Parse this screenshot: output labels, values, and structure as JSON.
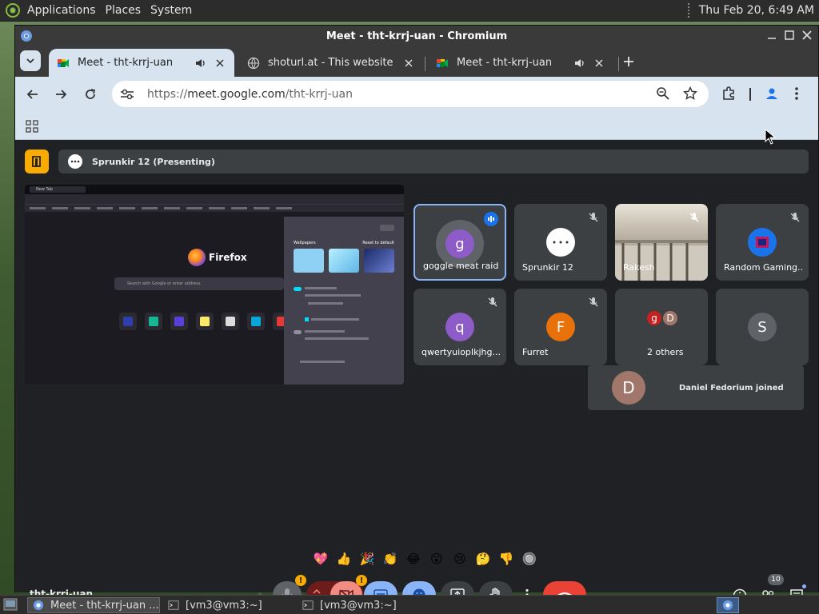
{
  "top_panel": {
    "menus": [
      "Applications",
      "Places",
      "System"
    ],
    "clock": "Thu Feb 20,  6:49 AM"
  },
  "window": {
    "title": "Meet - tht-krrj-uan - Chromium"
  },
  "tabs": [
    {
      "label": "Meet - tht-krrj-uan",
      "active": true,
      "audio": true
    },
    {
      "label": "shoturl.at - This website is fo",
      "active": false,
      "audio": false
    },
    {
      "label": "Meet - tht-krrj-uan",
      "active": false,
      "audio": true
    }
  ],
  "omnibox": {
    "scheme": "https://",
    "host": "meet.google.com",
    "path": "/tht-krrj-uan"
  },
  "meet": {
    "presenting_label": "Sprunkir 12 (Presenting)",
    "meeting_code": "tht-krrj-uan",
    "participant_count": "10",
    "shared_screen": {
      "tab_label": "New Tab",
      "brand": "Firefox",
      "search_placeholder": "Search with Google or enter address",
      "panel_heading": "Wallpapers",
      "panel_reset": "Reset to default",
      "panel_close": "Close",
      "wallpaper_names": [
        "Solid colors",
        "Abstract",
        "Photographs"
      ],
      "panel_shortcuts": "Shortcuts",
      "panel_sponsored": "Sponsored shortcuts",
      "panel_recent": "Recent activity",
      "panel_manage": "Manage more settings"
    },
    "tiles": [
      {
        "initial": "g",
        "name": "goggle meat raid",
        "color": "#8e5cc9",
        "speaking": true,
        "muted": false
      },
      {
        "initial": "",
        "name": "Sprunkir 12",
        "color": "#ffffff",
        "speaking": false,
        "muted": true
      },
      {
        "initial": "",
        "name": "Rakesh",
        "color": "#c9c2b8",
        "speaking": false,
        "muted": true
      },
      {
        "initial": "",
        "name": "Random Gaming...",
        "color": "#1a73e8",
        "speaking": false,
        "muted": true
      },
      {
        "initial": "q",
        "name": "qwertyuiopIkjhg...",
        "color": "#8e5cc9",
        "speaking": false,
        "muted": true
      },
      {
        "initial": "F",
        "name": "Furret",
        "color": "#e8710a",
        "speaking": false,
        "muted": true
      },
      {
        "initial": "g",
        "name": "2 others",
        "color": "#c5221f",
        "speaking": false,
        "muted": false
      },
      {
        "initial": "S",
        "name": "",
        "color": "#5f6368",
        "speaking": false,
        "muted": false
      }
    ],
    "others_second_initial": "D",
    "toast": {
      "initial": "D",
      "text": "Daniel Fedorium joined"
    },
    "reactions": [
      "💖",
      "👍",
      "🎉",
      "👏",
      "😂",
      "😮",
      "😢",
      "🤔",
      "👎",
      "🔘"
    ]
  },
  "taskbar": [
    {
      "label": "Meet - tht-krrj-uan ...",
      "active": true
    },
    {
      "label": "[vm3@vm3:~]",
      "active": false
    },
    {
      "label": "[vm3@vm3:~]",
      "active": false
    }
  ],
  "colors": {
    "meet_bg": "#202124",
    "tile_bg": "#3c4043",
    "accent_blue": "#8ab4f8",
    "end_call_red": "#ea4335",
    "present_yellow": "#f9ab00",
    "chrome_toolbar": "#d7e3ee"
  }
}
